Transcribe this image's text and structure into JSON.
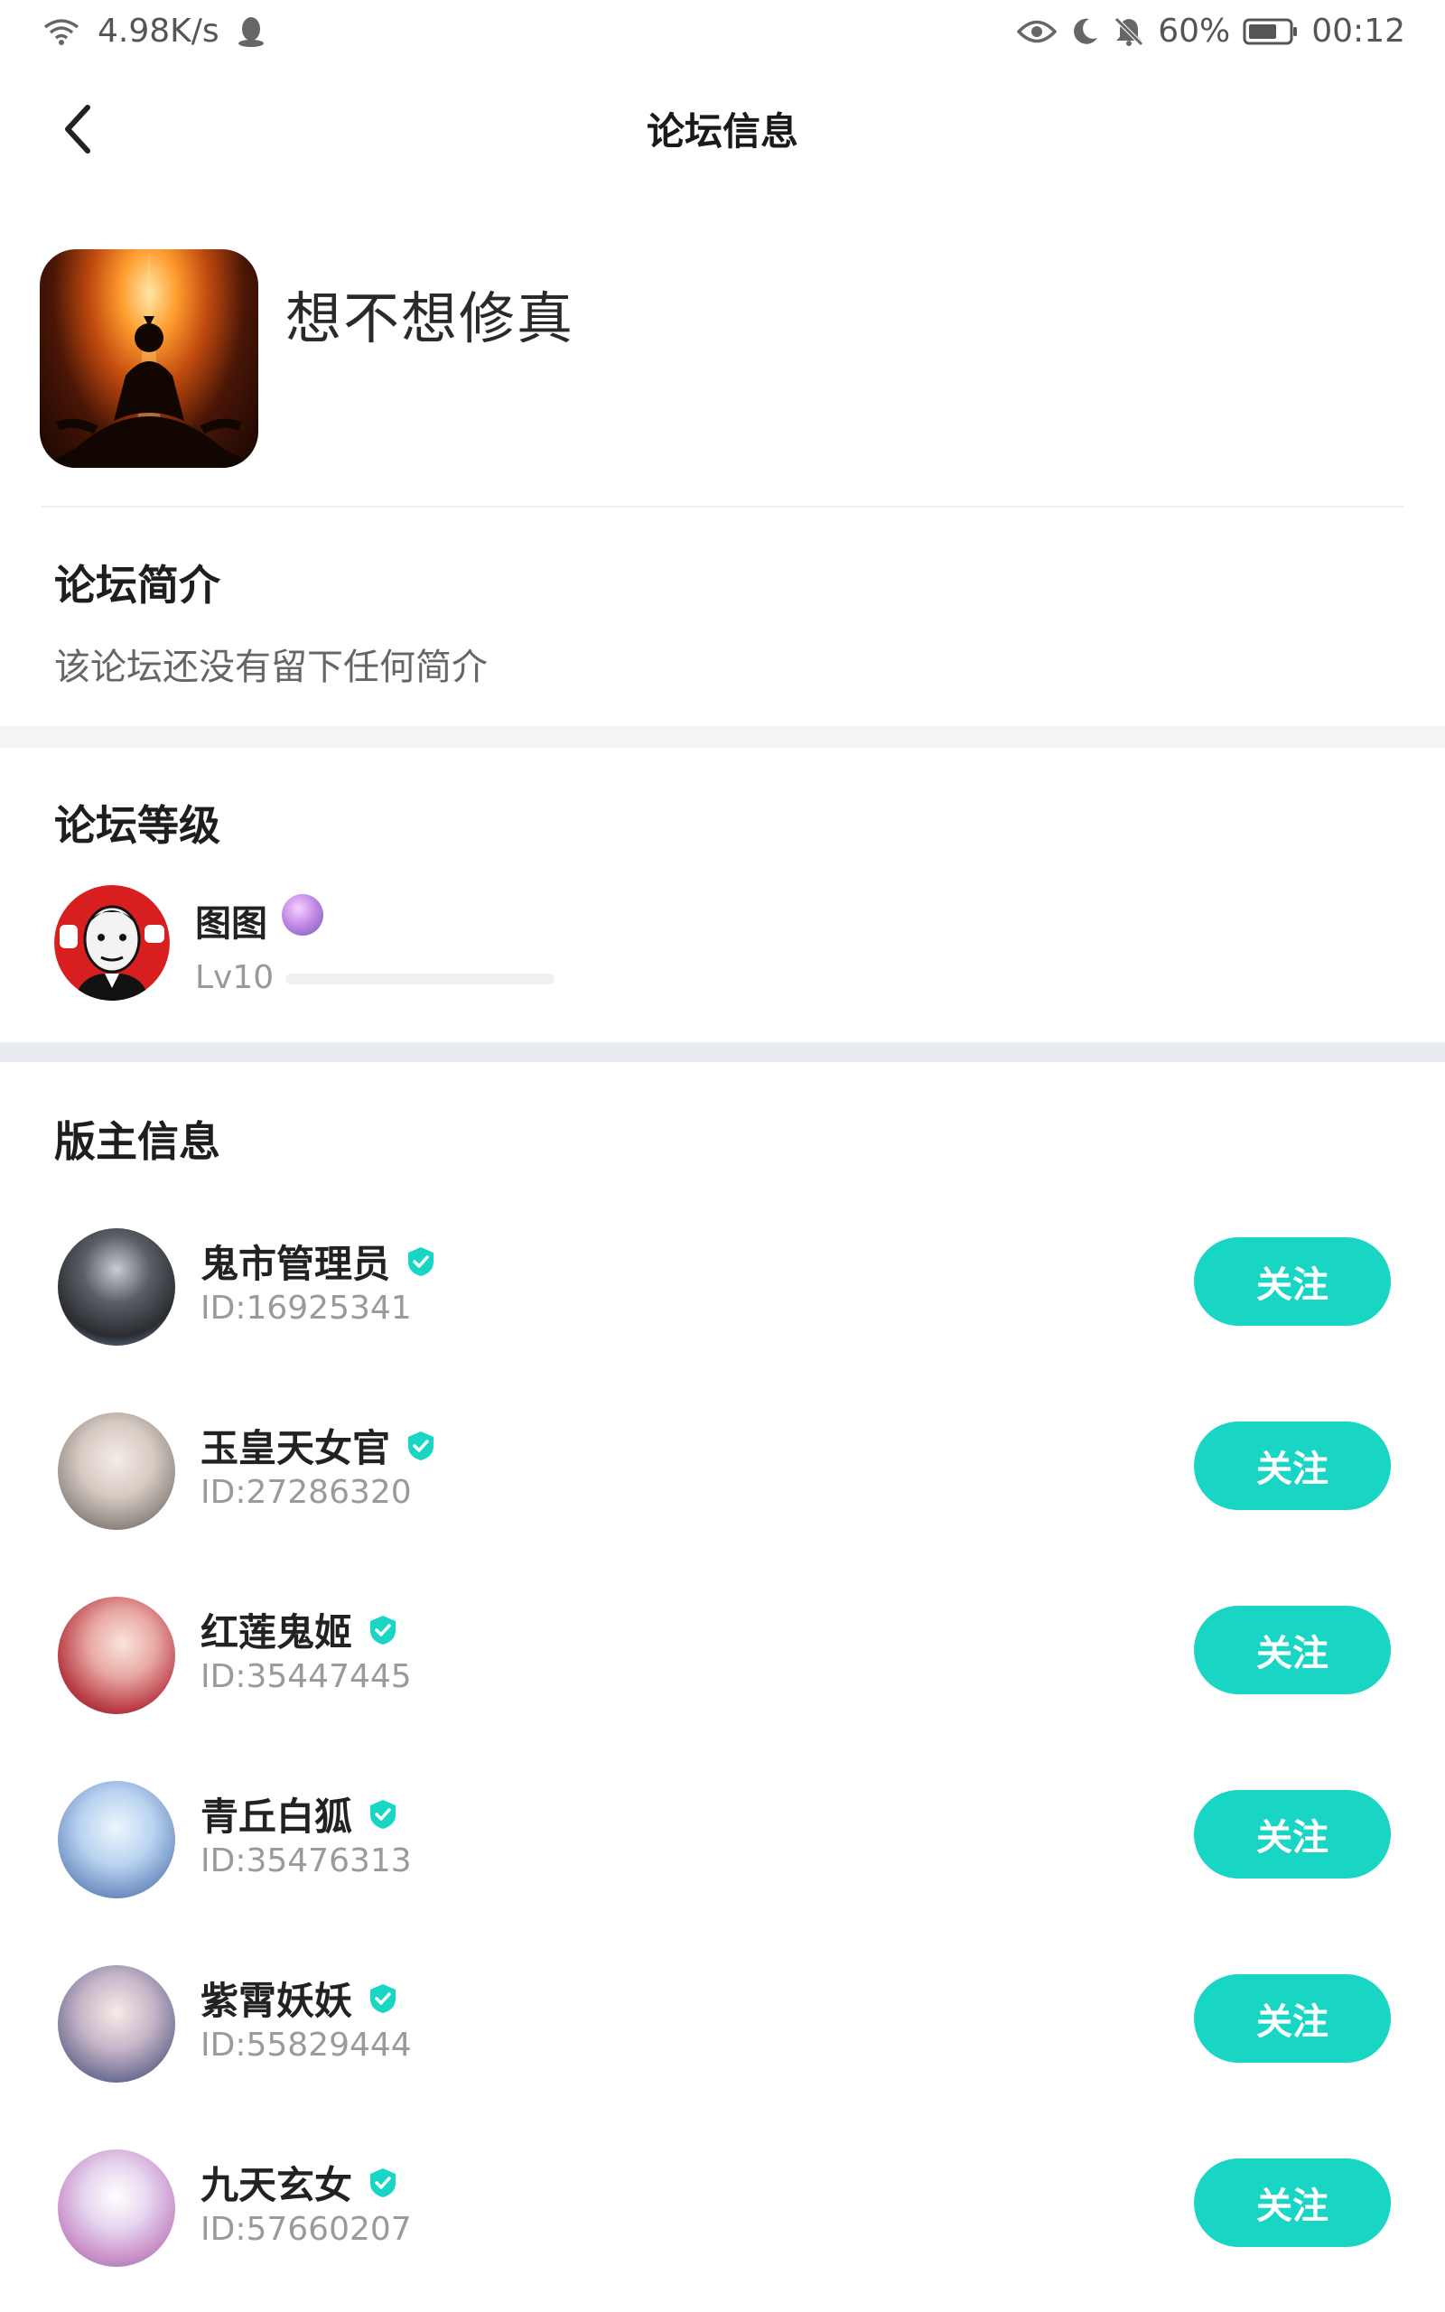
{
  "status_bar": {
    "net_speed": "4.98K/s",
    "battery": "60%",
    "time": "00:12",
    "icons": [
      "wifi-icon",
      "qq-icon",
      "eye-icon",
      "moon-icon",
      "mute-bell-icon",
      "battery-icon"
    ]
  },
  "header": {
    "title": "论坛信息",
    "back_icon": "chevron-left-icon"
  },
  "forum": {
    "name": "想不想修真"
  },
  "intro": {
    "title": "论坛简介",
    "text": "该论坛还没有留下任何简介"
  },
  "level": {
    "title": "论坛等级",
    "user_name": "图图",
    "level_label": "Lv10",
    "progress": 0.0
  },
  "moderators": {
    "title": "版主信息",
    "follow_label": "关注",
    "accent": "#19d6c4",
    "items": [
      {
        "name": "鬼市管理员",
        "id": "ID:16925341"
      },
      {
        "name": "玉皇天女官",
        "id": "ID:27286320"
      },
      {
        "name": "红莲鬼姬",
        "id": "ID:35447445"
      },
      {
        "name": "青丘白狐",
        "id": "ID:35476313"
      },
      {
        "name": "紫霄妖妖",
        "id": "ID:55829444"
      },
      {
        "name": "九天玄女",
        "id": "ID:57660207"
      }
    ]
  }
}
